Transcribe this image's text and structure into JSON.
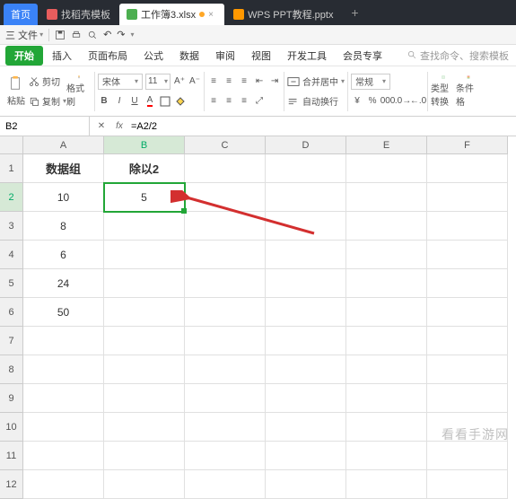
{
  "title_tabs": {
    "home": "首页",
    "t1": "找稻壳模板",
    "t2": "工作簿3.xlsx",
    "t3": "WPS PPT教程.pptx",
    "add": "+"
  },
  "top_toolbar": {
    "file": "三 文件",
    "undo": "↶",
    "redo": "↷"
  },
  "ribbon_tabs": {
    "start": "开始",
    "t1": "插入",
    "t2": "页面布局",
    "t3": "公式",
    "t4": "数据",
    "t5": "审阅",
    "t6": "视图",
    "t7": "开发工具",
    "t8": "会员专享",
    "search": "查找命令、搜索模板"
  },
  "ribbon": {
    "paste": "粘贴",
    "cut": "剪切",
    "copy": "复制",
    "format_painter": "格式刷",
    "font_name": "宋体",
    "font_size": "11",
    "bold": "B",
    "italic": "I",
    "underline": "U",
    "alignment": "对齐",
    "merge": "合并居中",
    "wrap": "自动换行",
    "num_fmt": "常规",
    "convert": "类型转换",
    "conditional": "条件格"
  },
  "name_box": "B2",
  "formula": "=A2/2",
  "columns": [
    "A",
    "B",
    "C",
    "D",
    "E",
    "F"
  ],
  "row_count": 12,
  "active": {
    "row": 2,
    "col": "B"
  },
  "chart_data": {
    "type": "table",
    "title": "",
    "columns": [
      "数据组",
      "除以2"
    ],
    "rows": [
      {
        "数据组": 10,
        "除以2": 5
      },
      {
        "数据组": 8,
        "除以2": null
      },
      {
        "数据组": 6,
        "除以2": null
      },
      {
        "数据组": 24,
        "除以2": null
      },
      {
        "数据组": 50,
        "除以2": null
      }
    ]
  },
  "cells": {
    "A1": "数据组",
    "B1": "除以2",
    "A2": "10",
    "B2": "5",
    "A3": "8",
    "A4": "6",
    "A5": "24",
    "A6": "50"
  },
  "watermark": "看看手游网"
}
